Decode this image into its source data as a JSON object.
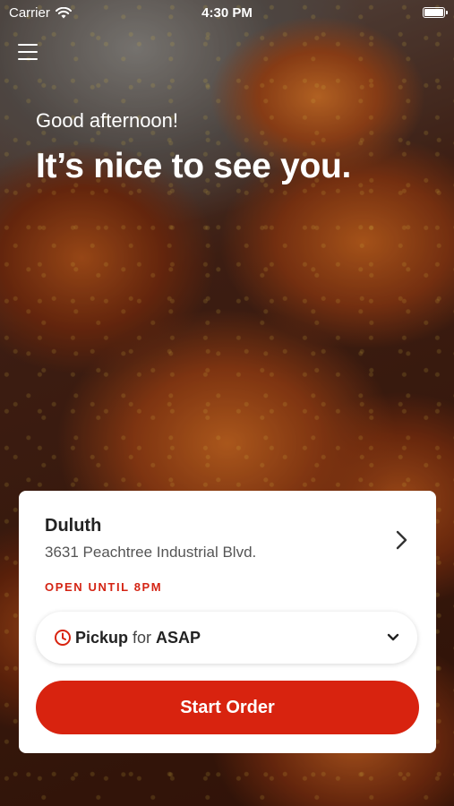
{
  "status_bar": {
    "carrier": "Carrier",
    "time": "4:30 PM"
  },
  "hero": {
    "greeting": "Good afternoon!",
    "headline": "It’s nice to see you."
  },
  "location": {
    "name": "Duluth",
    "address": "3631 Peachtree Industrial Blvd.",
    "status": "OPEN UNTIL 8PM"
  },
  "order_type": {
    "mode": "Pickup",
    "connector": "for",
    "timing": "ASAP"
  },
  "actions": {
    "start_order": "Start Order"
  },
  "colors": {
    "accent": "#d8230f",
    "status_red": "#d42414"
  },
  "icons": [
    "wifi-icon",
    "battery-icon",
    "menu-icon",
    "chevron-right-icon",
    "clock-icon",
    "chevron-down-icon"
  ]
}
